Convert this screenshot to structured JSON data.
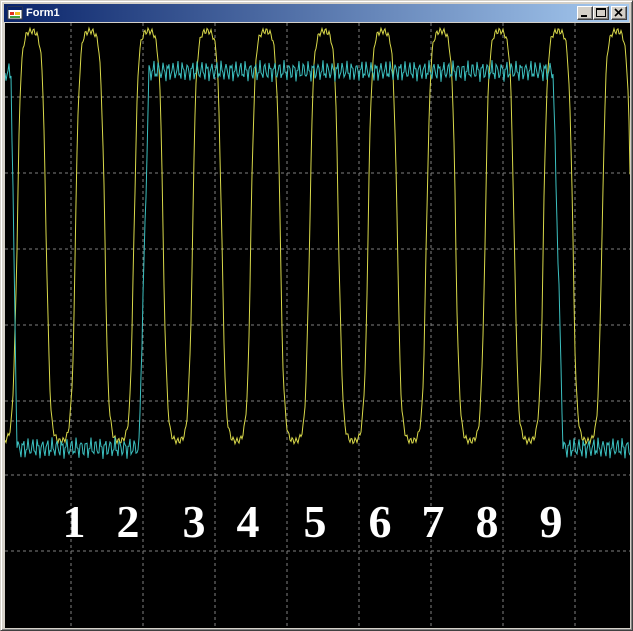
{
  "window": {
    "title": "Form1",
    "icons": {
      "app": "form-app-icon",
      "minimize": "minimize-icon",
      "maximize": "maximize-icon",
      "close": "close-icon"
    }
  },
  "colors": {
    "background": "#000000",
    "grid": "#808080",
    "trace_yellow": "#d9d94a",
    "trace_cyan": "#3cc0c0",
    "marker_text": "#ffffff"
  },
  "plot": {
    "grid": true,
    "markers": [
      "1",
      "2",
      "3",
      "4",
      "5",
      "6",
      "7",
      "8",
      "9"
    ]
  }
}
